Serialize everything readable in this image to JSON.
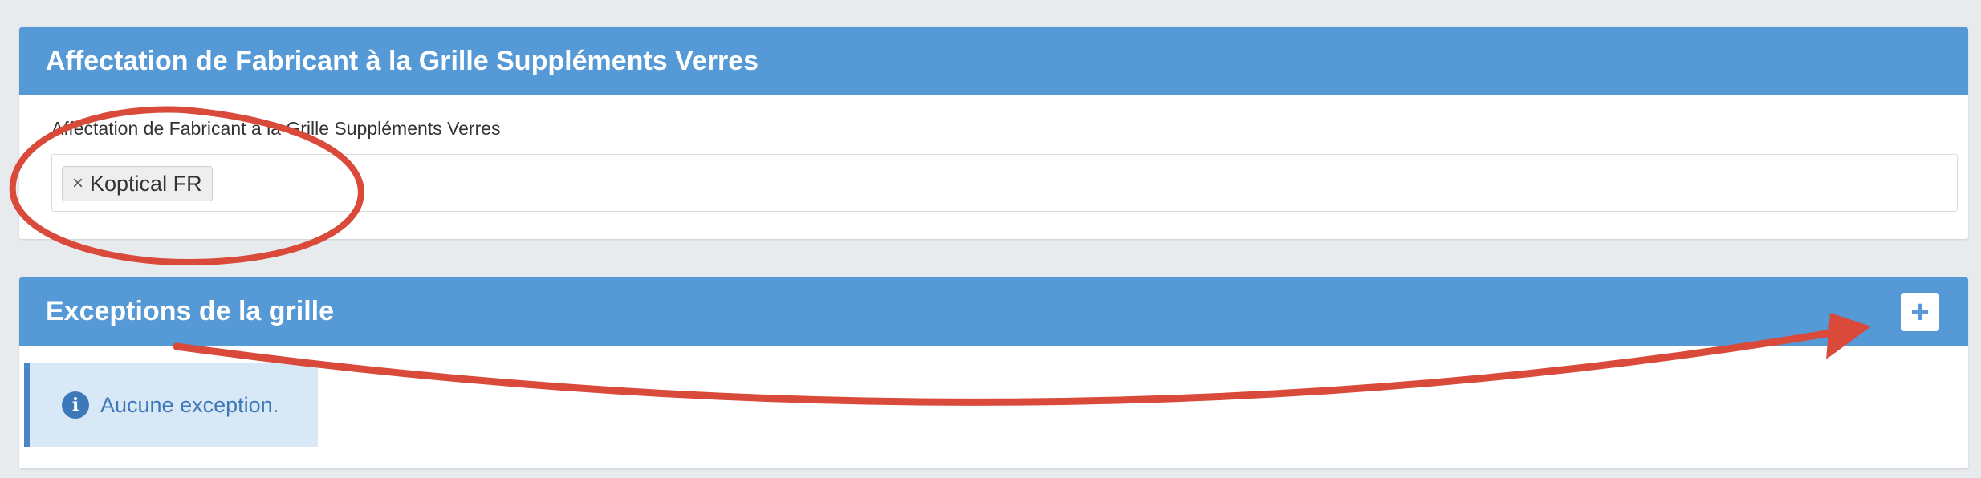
{
  "panel1": {
    "title": "Affectation de Fabricant à la Grille Suppléments Verres",
    "field_label": "Affectation de Fabricant à la Grille Suppléments Verres",
    "selected_tags": [
      {
        "remove": "×",
        "label": "Koptical FR"
      }
    ]
  },
  "panel2": {
    "title": "Exceptions de la grille",
    "add_button": "+",
    "empty_message": "Aucune exception.",
    "info_icon": "i"
  },
  "colors": {
    "header": "#5599d6",
    "background": "#e8ebee",
    "alert_bg": "#d9e8f6",
    "alert_text": "#3d78b8",
    "annotation": "#d94a3a"
  },
  "icons": {
    "tag_remove": "close-icon",
    "add": "plus-icon",
    "info": "info-circle-icon"
  }
}
